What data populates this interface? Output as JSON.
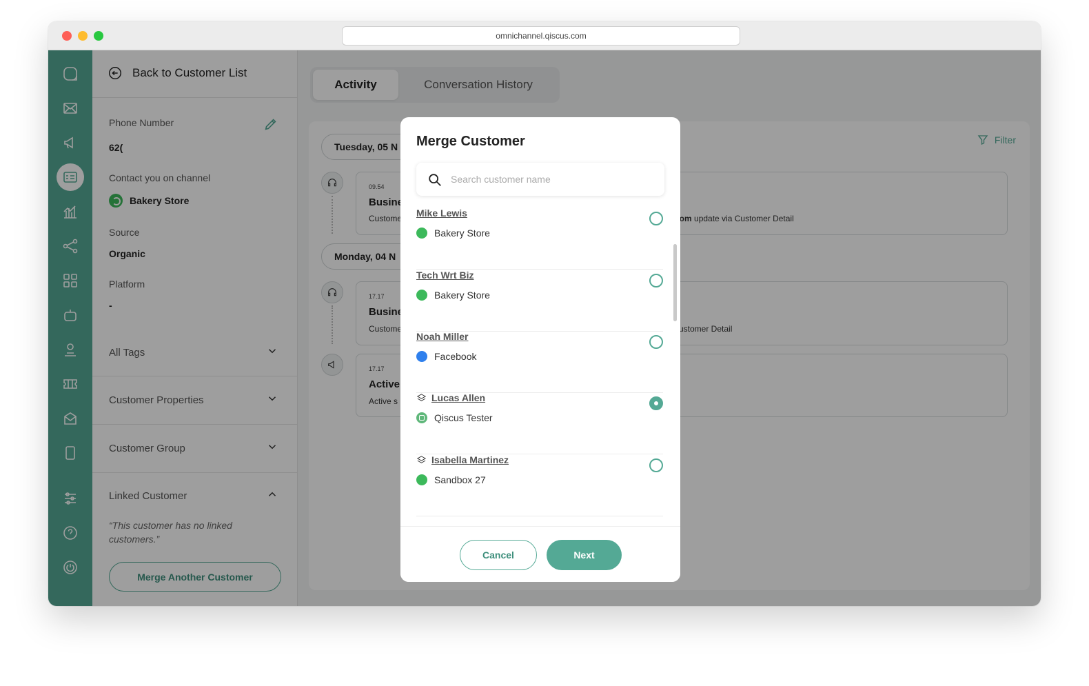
{
  "browser": {
    "url": "omnichannel.qiscus.com"
  },
  "customer_panel": {
    "back_label": "Back to Customer List",
    "phone_label": "Phone Number",
    "phone_value": "62(",
    "channel_label": "Contact you on channel",
    "channel_value": "Bakery Store",
    "source_label": "Source",
    "source_value": "Organic",
    "platform_label": "Platform",
    "platform_value": "-",
    "tags_label": "All Tags",
    "properties_label": "Customer Properties",
    "group_label": "Customer Group",
    "linked_label": "Linked Customer",
    "linked_note": "“This customer has no linked customers.”",
    "merge_button": "Merge Another Customer"
  },
  "tabs": [
    {
      "label": "Activity",
      "active": true
    },
    {
      "label": "Conversation History",
      "active": false
    }
  ],
  "filter_label": "Filter",
  "timeline": {
    "dates": [
      "Tuesday, 05 N",
      "Monday, 04 N"
    ],
    "cards": [
      {
        "time": "09.54",
        "title": "Busine",
        "desc": "Custome",
        "tail_bold": "il.com",
        "tail": " update via Customer Detail"
      },
      {
        "time": "17.17",
        "title": "Busine",
        "desc": "Custome",
        "tail": "ustomer Detail"
      },
      {
        "time": "17.17",
        "title": "Active",
        "desc": "Active s"
      }
    ]
  },
  "modal": {
    "title": "Merge Customer",
    "search_placeholder": "Search customer name",
    "customers": [
      {
        "name": "Mike Lewis",
        "channel": "Bakery Store",
        "channel_type": "whatsapp",
        "linked": false,
        "selected": false
      },
      {
        "name": "Tech Wrt Biz",
        "channel": "Bakery Store",
        "channel_type": "whatsapp",
        "linked": false,
        "selected": false
      },
      {
        "name": "Noah Miller",
        "channel": "Facebook",
        "channel_type": "facebook",
        "linked": false,
        "selected": false
      },
      {
        "name": "Lucas Allen",
        "channel": "Qiscus Tester",
        "channel_type": "qiscus",
        "linked": true,
        "selected": true
      },
      {
        "name": "Isabella Martinez",
        "channel": "Sandbox 27",
        "channel_type": "whatsapp",
        "linked": true,
        "selected": false
      }
    ],
    "cancel_label": "Cancel",
    "next_label": "Next"
  },
  "colors": {
    "brand": "#54a995",
    "overlay": "rgba(0,0,0,0.38)"
  },
  "icons": [
    "logo-icon",
    "inbox-icon",
    "broadcast-icon",
    "customer-icon",
    "analytics-icon",
    "integration-icon",
    "apps-icon",
    "bot-icon",
    "agent-icon",
    "ticket-icon",
    "mail-icon",
    "mobile-icon",
    "settings-icon",
    "help-icon",
    "power-icon"
  ]
}
